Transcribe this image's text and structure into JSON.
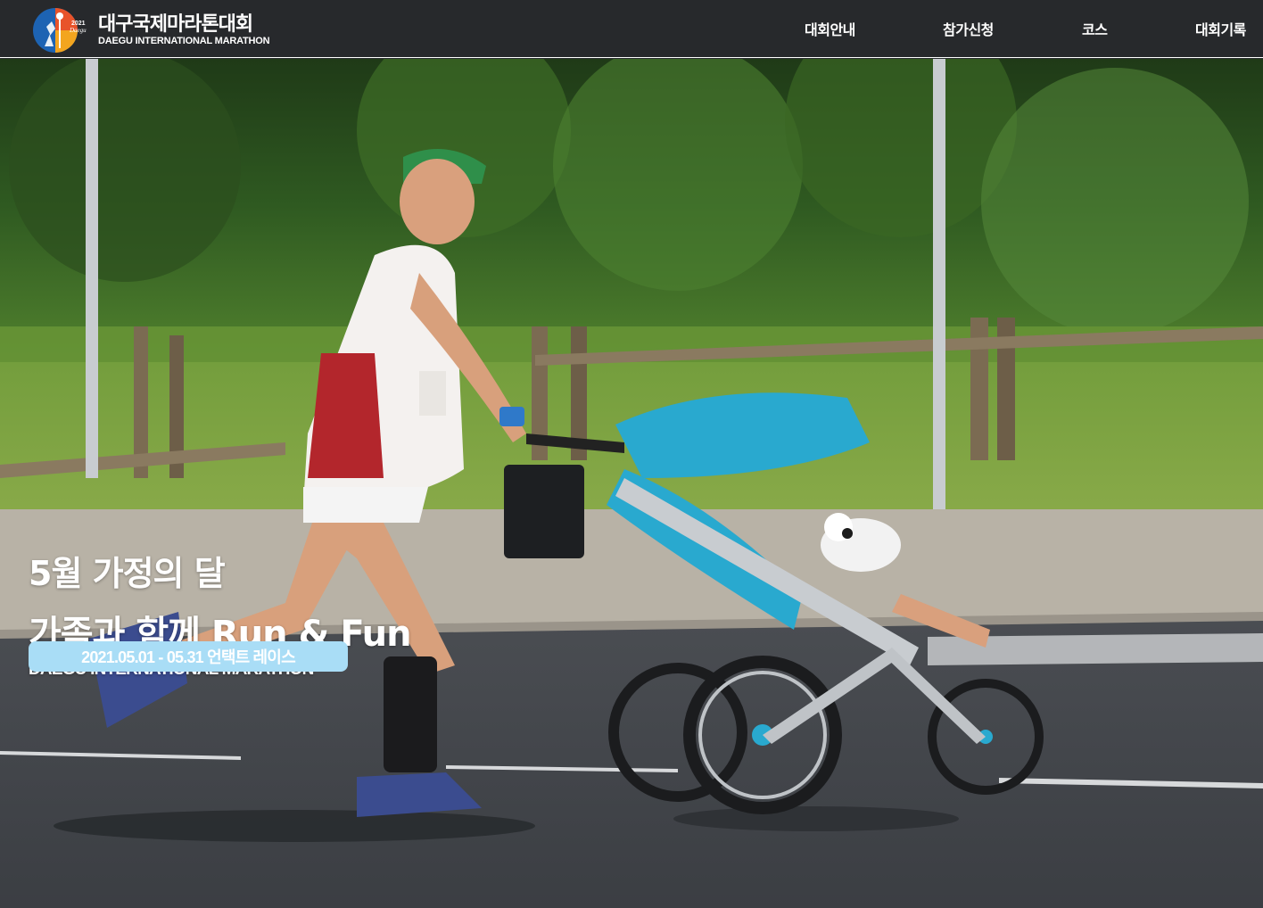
{
  "brand": {
    "name_ko": "대구국제마라톤대회",
    "name_en": "DAEGU INTERNATIONAL MARATHON",
    "emblem_year": "2021",
    "emblem_city": "Daegu"
  },
  "nav": {
    "items": [
      {
        "label": "대회안내"
      },
      {
        "label": "참가신청"
      },
      {
        "label": "코스"
      },
      {
        "label": "대회기록"
      }
    ]
  },
  "hero": {
    "line1": "5월 가정의 달",
    "line2": "가족과 함께 Run & Fun",
    "line3": "DAEGU INTERNATIONAL MARATHON",
    "badge": "2021.05.01 - 05.31 언택트 레이스",
    "image_icon": "runner-with-stroller-photo"
  },
  "colors": {
    "header_bg": "#27292c",
    "badge_bg": "#a9ddf6",
    "stroller_blue": "#29a9cf"
  }
}
